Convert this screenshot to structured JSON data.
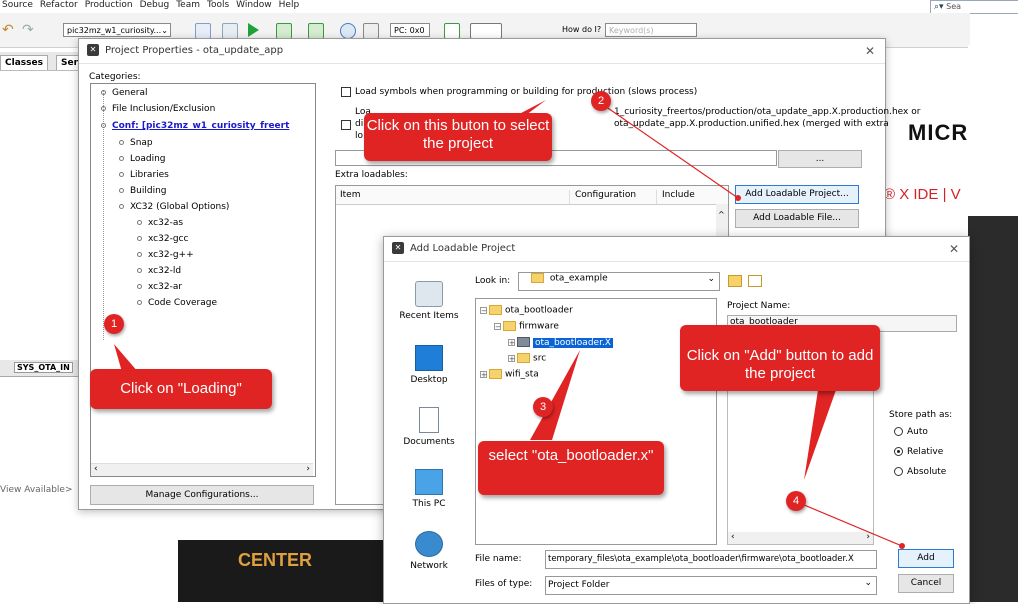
{
  "menu": [
    "Source",
    "Refactor",
    "Production",
    "Debug",
    "Team",
    "Tools",
    "Window",
    "Help"
  ],
  "search": {
    "label": "Sea"
  },
  "toolbar": {
    "project_combo": "pic32mz_w1_curiosity...",
    "pc": "PC: 0x0",
    "howdoi": "How do I?",
    "keyword_placeholder": "Keyword(s)"
  },
  "side_tabs": [
    "Classes",
    "Serv"
  ],
  "bg": {
    "brand": "MICR",
    "ide_text": "® X IDE  |  V",
    "center": "CENTER",
    "sys_tab": "SYS_OTA_IN",
    "view_available": "View Available>"
  },
  "dlg1": {
    "title": "Project Properties - ota_update_app",
    "categories_label": "Categories:",
    "categories": [
      {
        "label": "General",
        "level": 0
      },
      {
        "label": "File Inclusion/Exclusion",
        "level": 0
      },
      {
        "label": "Conf: [pic32mz_w1_curiosity_freert",
        "level": 0,
        "selected": true
      },
      {
        "label": "Snap",
        "level": 1
      },
      {
        "label": "Loading",
        "level": 1
      },
      {
        "label": "Libraries",
        "level": 1
      },
      {
        "label": "Building",
        "level": 1
      },
      {
        "label": "XC32 (Global Options)",
        "level": 1
      },
      {
        "label": "xc32-as",
        "level": 2
      },
      {
        "label": "xc32-gcc",
        "level": 2
      },
      {
        "label": "xc32-g++",
        "level": 2
      },
      {
        "label": "xc32-ld",
        "level": 2
      },
      {
        "label": "xc32-ar",
        "level": 2
      },
      {
        "label": "Code Coverage",
        "level": 2
      }
    ],
    "manage_button": "Manage Configurations...",
    "load_symbols": "Load symbols when programming or building for production (slows process)",
    "loa_line1": "Loa",
    "loa_line1_right": "1_curiosity_freertos/production/ota_update_app.X.production.hex or",
    "di_line2": "di",
    "di_line2_right": "ota_update_app.X.production.unified.hex (merged with extra",
    "lo_line3": "lo",
    "browse_button": "...",
    "extra_loadables": "Extra loadables:",
    "columns": [
      "Item",
      "Configuration",
      "Include"
    ],
    "add_project_button": "Add Loadable Project...",
    "add_file_button": "Add Loadable File..."
  },
  "dlg2": {
    "title": "Add Loadable Project",
    "look_in_label": "Look in:",
    "look_in_value": "ota_example",
    "places": [
      "Recent Items",
      "Desktop",
      "Documents",
      "This PC",
      "Network"
    ],
    "tree": [
      {
        "label": "ota_bootloader",
        "level": 0
      },
      {
        "label": "firmware",
        "level": 1
      },
      {
        "label": "ota_bootloader.X",
        "level": 2,
        "selected": true
      },
      {
        "label": "src",
        "level": 2
      },
      {
        "label": "wifi_sta",
        "level": 0
      }
    ],
    "project_name_label": "Project Name:",
    "project_name_value": "ota_bootloader",
    "store_path_label": "Store path as:",
    "store_options": [
      {
        "label": "Auto",
        "checked": false
      },
      {
        "label": "Relative",
        "checked": true
      },
      {
        "label": "Absolute",
        "checked": false
      }
    ],
    "file_name_label": "File name:",
    "file_name_value": "temporary_files\\ota_example\\ota_bootloader\\firmware\\ota_bootloader.X",
    "files_type_label": "Files of type:",
    "files_type_value": "Project Folder",
    "add_button": "Add",
    "cancel_button": "Cancel"
  },
  "annotations": {
    "c1": "Click on \"Loading\"",
    "c2": "Click on this buton to select the project",
    "c3": "select \"ota_bootloader.x\"",
    "c4": "Click on \"Add\" button to add the project",
    "b1": "1",
    "b2": "2",
    "b3": "3",
    "b4": "4"
  },
  "colors": {
    "annotation": "#e02424",
    "selection": "#0a64d6",
    "link": "#1a1acc"
  }
}
